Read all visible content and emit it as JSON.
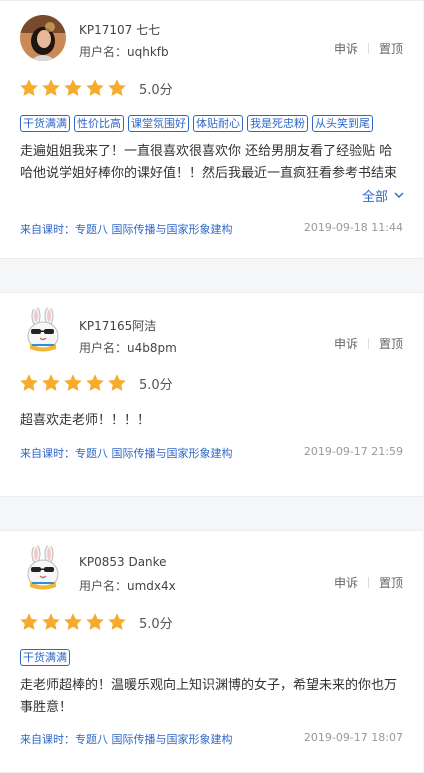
{
  "colors": {
    "accent": "#2f67c7",
    "star": "#f6ab2c"
  },
  "reviews": [
    {
      "user": "KP17107 七七",
      "id_label": "用户名：",
      "id": "uqhkfb",
      "avatar_icon": "user-photo-avatar",
      "report": "申诉",
      "top": "置顶",
      "rating_stars": 5,
      "score": "5.0分",
      "tags": [
        "干货满满",
        "性价比高",
        "课堂氛围好",
        "体贴耐心",
        "我是死忠粉",
        "从头笑到尾"
      ],
      "content": "走遍姐姐我来了！一直很喜欢很喜欢你 还给男朋友看了经验贴 哈哈他说学姐好棒你的课好值！！然后我最近一直疯狂看参考书结束二轮在专题用的时间不多 里面问题上也不是很",
      "expand": "全部",
      "source": "来自课时：专题八 国际传播与国家形象建构",
      "time": "2019-09-18 11:44"
    },
    {
      "user": "KP17165阿洁",
      "id_label": "用户名：",
      "id": "u4b8pm",
      "avatar_icon": "bunny-sunglasses-avatar",
      "report": "申诉",
      "top": "置顶",
      "rating_stars": 5,
      "score": "5.0分",
      "tags": [],
      "content": "超喜欢走老师！！！！",
      "source": "来自课时：专题八 国际传播与国家形象建构",
      "time": "2019-09-17 21:59"
    },
    {
      "user": "KP0853 Danke",
      "id_label": "用户名：",
      "id": "umdx4x",
      "avatar_icon": "bunny-sunglasses-avatar",
      "report": "申诉",
      "top": "置顶",
      "rating_stars": 5,
      "score": "5.0分",
      "tags": [
        "干货满满"
      ],
      "content": "走老师超棒的！温暖乐观向上知识渊博的女子，希望未来的你也万事胜意！",
      "source": "来自课时：专题八 国际传播与国家形象建构",
      "time": "2019-09-17 18:07"
    }
  ]
}
